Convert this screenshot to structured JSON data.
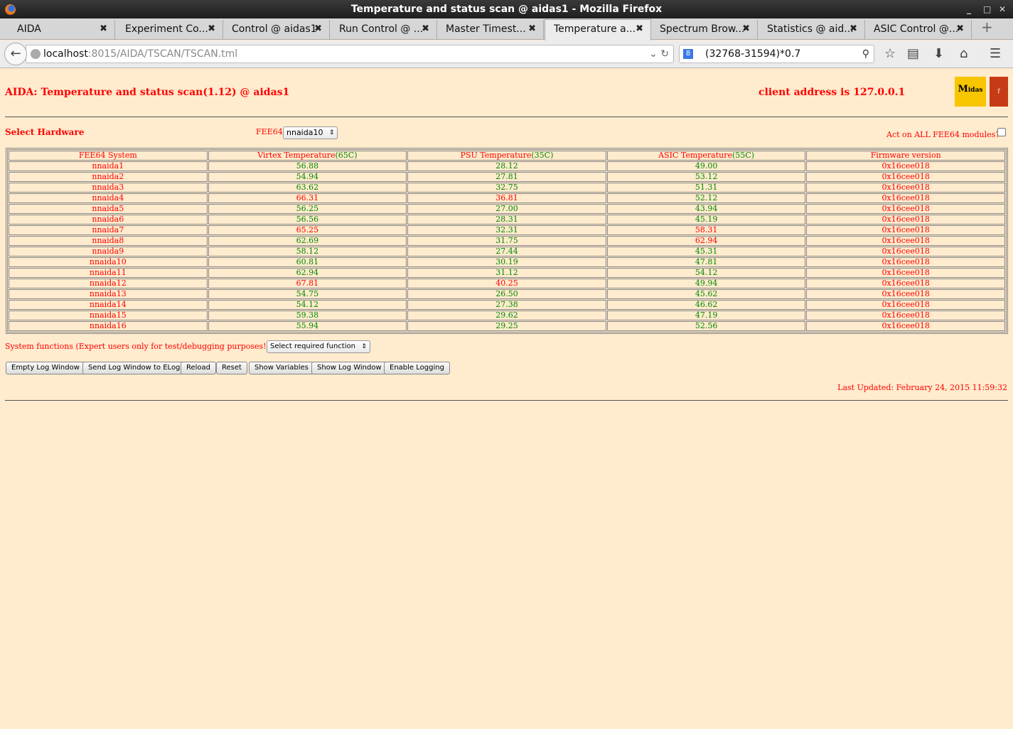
{
  "window": {
    "title": "Temperature and status scan @ aidas1 - Mozilla Firefox"
  },
  "tabs": [
    {
      "label": "AIDA"
    },
    {
      "label": "Experiment Co..."
    },
    {
      "label": "Control @ aidas1"
    },
    {
      "label": "Run Control @ ..."
    },
    {
      "label": "Master Timest..."
    },
    {
      "label": "Temperature a...",
      "active": true
    },
    {
      "label": "Spectrum Brow..."
    },
    {
      "label": "Statistics @ aid..."
    },
    {
      "label": "ASIC Control @..."
    }
  ],
  "nav": {
    "url_host": "localhost",
    "url_path": ":8015/AIDA/TSCAN/TSCAN.tml",
    "search_value": "(32768-31594)*0.7"
  },
  "page": {
    "title": "AIDA: Temperature and status scan(1.12) @ aidas1",
    "client_address": "client address is 127.0.0.1",
    "logos": {
      "midas": "Midas",
      "fermi": "FERMI"
    },
    "select_hardware": "Select Hardware",
    "fee64_label": "FEE64",
    "fee64_selected": "nnaida10",
    "act_all_label": "Act on ALL FEE64 modules?",
    "act_all_checked": false,
    "headers": [
      {
        "text": "FEE64 System",
        "limit": ""
      },
      {
        "text": "Virtex Temperature",
        "limit": "(65C)"
      },
      {
        "text": "PSU Temperature",
        "limit": "(35C)"
      },
      {
        "text": "ASIC Temperature",
        "limit": "(55C)"
      },
      {
        "text": "Firmware version",
        "limit": ""
      }
    ],
    "rows": [
      {
        "name": "nnaida1",
        "virtex": "56.88",
        "psu": "28.12",
        "asic": "49.00",
        "fw": "0x16cee018",
        "alarm": [
          false,
          false,
          false
        ]
      },
      {
        "name": "nnaida2",
        "virtex": "54.94",
        "psu": "27.81",
        "asic": "53.12",
        "fw": "0x16cee018",
        "alarm": [
          false,
          false,
          false
        ]
      },
      {
        "name": "nnaida3",
        "virtex": "63.62",
        "psu": "32.75",
        "asic": "51.31",
        "fw": "0x16cee018",
        "alarm": [
          false,
          false,
          false
        ]
      },
      {
        "name": "nnaida4",
        "virtex": "66.31",
        "psu": "36.81",
        "asic": "52.12",
        "fw": "0x16cee018",
        "alarm": [
          true,
          true,
          false
        ]
      },
      {
        "name": "nnaida5",
        "virtex": "56.25",
        "psu": "27.00",
        "asic": "43.94",
        "fw": "0x16cee018",
        "alarm": [
          false,
          false,
          false
        ]
      },
      {
        "name": "nnaida6",
        "virtex": "56.56",
        "psu": "28.31",
        "asic": "45.19",
        "fw": "0x16cee018",
        "alarm": [
          false,
          false,
          false
        ]
      },
      {
        "name": "nnaida7",
        "virtex": "65.25",
        "psu": "32.31",
        "asic": "58.31",
        "fw": "0x16cee018",
        "alarm": [
          true,
          false,
          true
        ]
      },
      {
        "name": "nnaida8",
        "virtex": "62.69",
        "psu": "31.75",
        "asic": "62.94",
        "fw": "0x16cee018",
        "alarm": [
          false,
          false,
          true
        ]
      },
      {
        "name": "nnaida9",
        "virtex": "58.12",
        "psu": "27.44",
        "asic": "45.31",
        "fw": "0x16cee018",
        "alarm": [
          false,
          false,
          false
        ]
      },
      {
        "name": "nnaida10",
        "virtex": "60.81",
        "psu": "30.19",
        "asic": "47.81",
        "fw": "0x16cee018",
        "alarm": [
          false,
          false,
          false
        ]
      },
      {
        "name": "nnaida11",
        "virtex": "62.94",
        "psu": "31.12",
        "asic": "54.12",
        "fw": "0x16cee018",
        "alarm": [
          false,
          false,
          false
        ]
      },
      {
        "name": "nnaida12",
        "virtex": "67.81",
        "psu": "40.25",
        "asic": "49.94",
        "fw": "0x16cee018",
        "alarm": [
          true,
          true,
          false
        ]
      },
      {
        "name": "nnaida13",
        "virtex": "54.75",
        "psu": "26.50",
        "asic": "45.62",
        "fw": "0x16cee018",
        "alarm": [
          false,
          false,
          false
        ]
      },
      {
        "name": "nnaida14",
        "virtex": "54.12",
        "psu": "27.38",
        "asic": "46.62",
        "fw": "0x16cee018",
        "alarm": [
          false,
          false,
          false
        ]
      },
      {
        "name": "nnaida15",
        "virtex": "59.38",
        "psu": "29.62",
        "asic": "47.19",
        "fw": "0x16cee018",
        "alarm": [
          false,
          false,
          false
        ]
      },
      {
        "name": "nnaida16",
        "virtex": "55.94",
        "psu": "29.25",
        "asic": "52.56",
        "fw": "0x16cee018",
        "alarm": [
          false,
          false,
          false
        ]
      }
    ],
    "system_functions_label": "System functions (Expert users only for test/debugging purposes!!!)",
    "system_function_selected": "Select required function",
    "buttons": [
      "Empty Log Window",
      "Send Log Window to ELog",
      "Reload",
      "Reset",
      "Show Variables",
      "Show Log Window",
      "Enable Logging"
    ],
    "last_updated": "Last Updated: February 24, 2015 11:59:32",
    "colors": {
      "alarm": "#ff0000",
      "ok": "#008800",
      "text": "#ff0000",
      "background": "#ffebcd"
    }
  }
}
